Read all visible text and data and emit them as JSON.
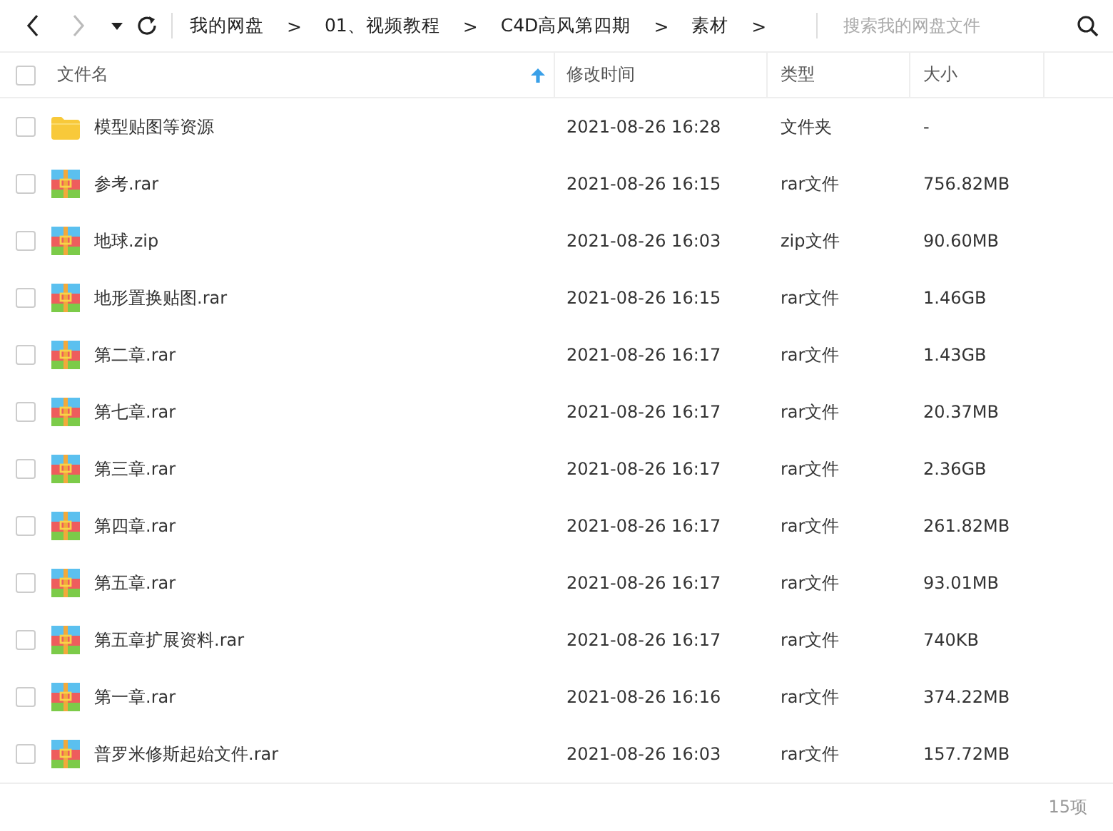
{
  "toolbar": {
    "back": {
      "disabled": false
    },
    "forward": {
      "disabled": true
    },
    "breadcrumbs": [
      {
        "label": "我的网盘"
      },
      {
        "label": "01、视频教程"
      },
      {
        "label": "C4D高风第四期"
      },
      {
        "label": "素材"
      }
    ],
    "separator": ">",
    "search": {
      "placeholder": "搜索我的网盘文件"
    }
  },
  "table": {
    "select_all": {
      "checked": false
    },
    "columns": [
      {
        "label": "文件名",
        "sorted": true
      },
      {
        "label": "修改时间",
        "sorted": false
      },
      {
        "label": "类型",
        "sorted": false
      },
      {
        "label": "大小",
        "sorted": false
      }
    ],
    "rows": [
      {
        "kind": "folder",
        "checked": false,
        "name": "模型贴图等资源",
        "modified": "2021-08-26 16:28",
        "type": "文件夹",
        "size": "-"
      },
      {
        "kind": "archive",
        "checked": false,
        "name": "参考.rar",
        "modified": "2021-08-26 16:15",
        "type": "rar文件",
        "size": "756.82MB"
      },
      {
        "kind": "archive",
        "checked": false,
        "name": "地球.zip",
        "modified": "2021-08-26 16:03",
        "type": "zip文件",
        "size": "90.60MB"
      },
      {
        "kind": "archive",
        "checked": false,
        "name": "地形置换贴图.rar",
        "modified": "2021-08-26 16:15",
        "type": "rar文件",
        "size": "1.46GB"
      },
      {
        "kind": "archive",
        "checked": false,
        "name": "第二章.rar",
        "modified": "2021-08-26 16:17",
        "type": "rar文件",
        "size": "1.43GB"
      },
      {
        "kind": "archive",
        "checked": false,
        "name": "第七章.rar",
        "modified": "2021-08-26 16:17",
        "type": "rar文件",
        "size": "20.37MB"
      },
      {
        "kind": "archive",
        "checked": false,
        "name": "第三章.rar",
        "modified": "2021-08-26 16:17",
        "type": "rar文件",
        "size": "2.36GB"
      },
      {
        "kind": "archive",
        "checked": false,
        "name": "第四章.rar",
        "modified": "2021-08-26 16:17",
        "type": "rar文件",
        "size": "261.82MB"
      },
      {
        "kind": "archive",
        "checked": false,
        "name": "第五章.rar",
        "modified": "2021-08-26 16:17",
        "type": "rar文件",
        "size": "93.01MB"
      },
      {
        "kind": "archive",
        "checked": false,
        "name": "第五章扩展资料.rar",
        "modified": "2021-08-26 16:17",
        "type": "rar文件",
        "size": "740KB"
      },
      {
        "kind": "archive",
        "checked": false,
        "name": "第一章.rar",
        "modified": "2021-08-26 16:16",
        "type": "rar文件",
        "size": "374.22MB"
      },
      {
        "kind": "archive",
        "checked": false,
        "name": "普罗米修斯起始文件.rar",
        "modified": "2021-08-26 16:03",
        "type": "rar文件",
        "size": "157.72MB"
      }
    ]
  },
  "status_bar": {
    "count": "15项"
  }
}
